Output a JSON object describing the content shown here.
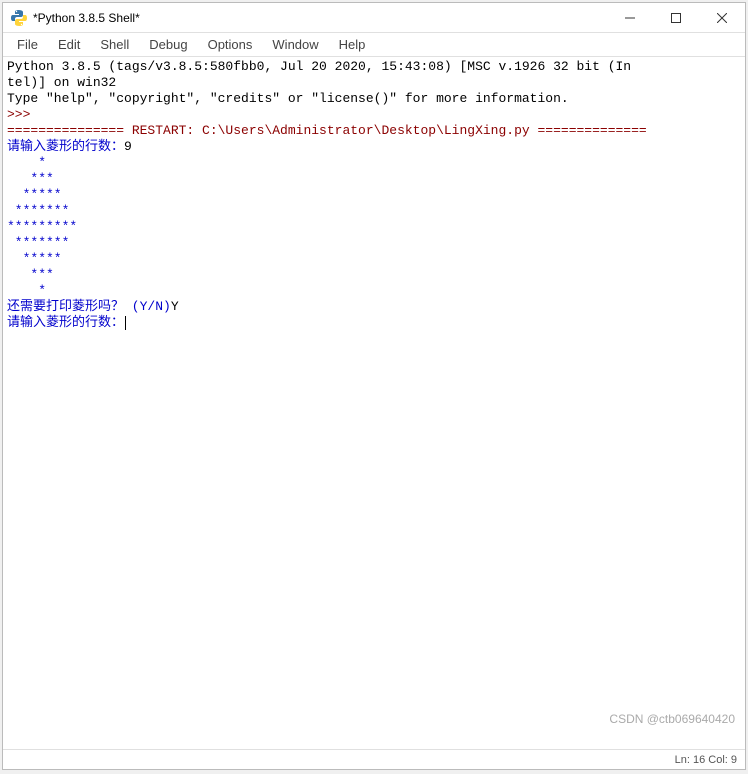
{
  "titlebar": {
    "title": "*Python 3.8.5 Shell*"
  },
  "menubar": {
    "items": [
      "File",
      "Edit",
      "Shell",
      "Debug",
      "Options",
      "Window",
      "Help"
    ]
  },
  "content": {
    "header_line1": "Python 3.8.5 (tags/v3.8.5:580fbb0, Jul 20 2020, 15:43:08) [MSC v.1926 32 bit (In",
    "header_line2": "tel)] on win32",
    "header_line3": "Type \"help\", \"copyright\", \"credits\" or \"license()\" for more information.",
    "prompt": ">>> ",
    "restart_line": "=============== RESTART: C:\\Users\\Administrator\\Desktop\\LingXing.py ==============",
    "input_prompt1": "请输入菱形的行数：",
    "input_value1": "9",
    "diamond_line1": "    *",
    "diamond_line2": "   ***",
    "diamond_line3": "  *****",
    "diamond_line4": " *******",
    "diamond_line5": "*********",
    "diamond_line6": " *******",
    "diamond_line7": "  *****",
    "diamond_line8": "   ***",
    "diamond_line9": "    *",
    "input_prompt2": "还需要打印菱形吗？ (Y/N)",
    "input_value2": "Y",
    "input_prompt3": "请输入菱形的行数："
  },
  "statusbar": {
    "position": "Ln: 16  Col: 9"
  },
  "watermark": "CSDN @ctb069640420"
}
